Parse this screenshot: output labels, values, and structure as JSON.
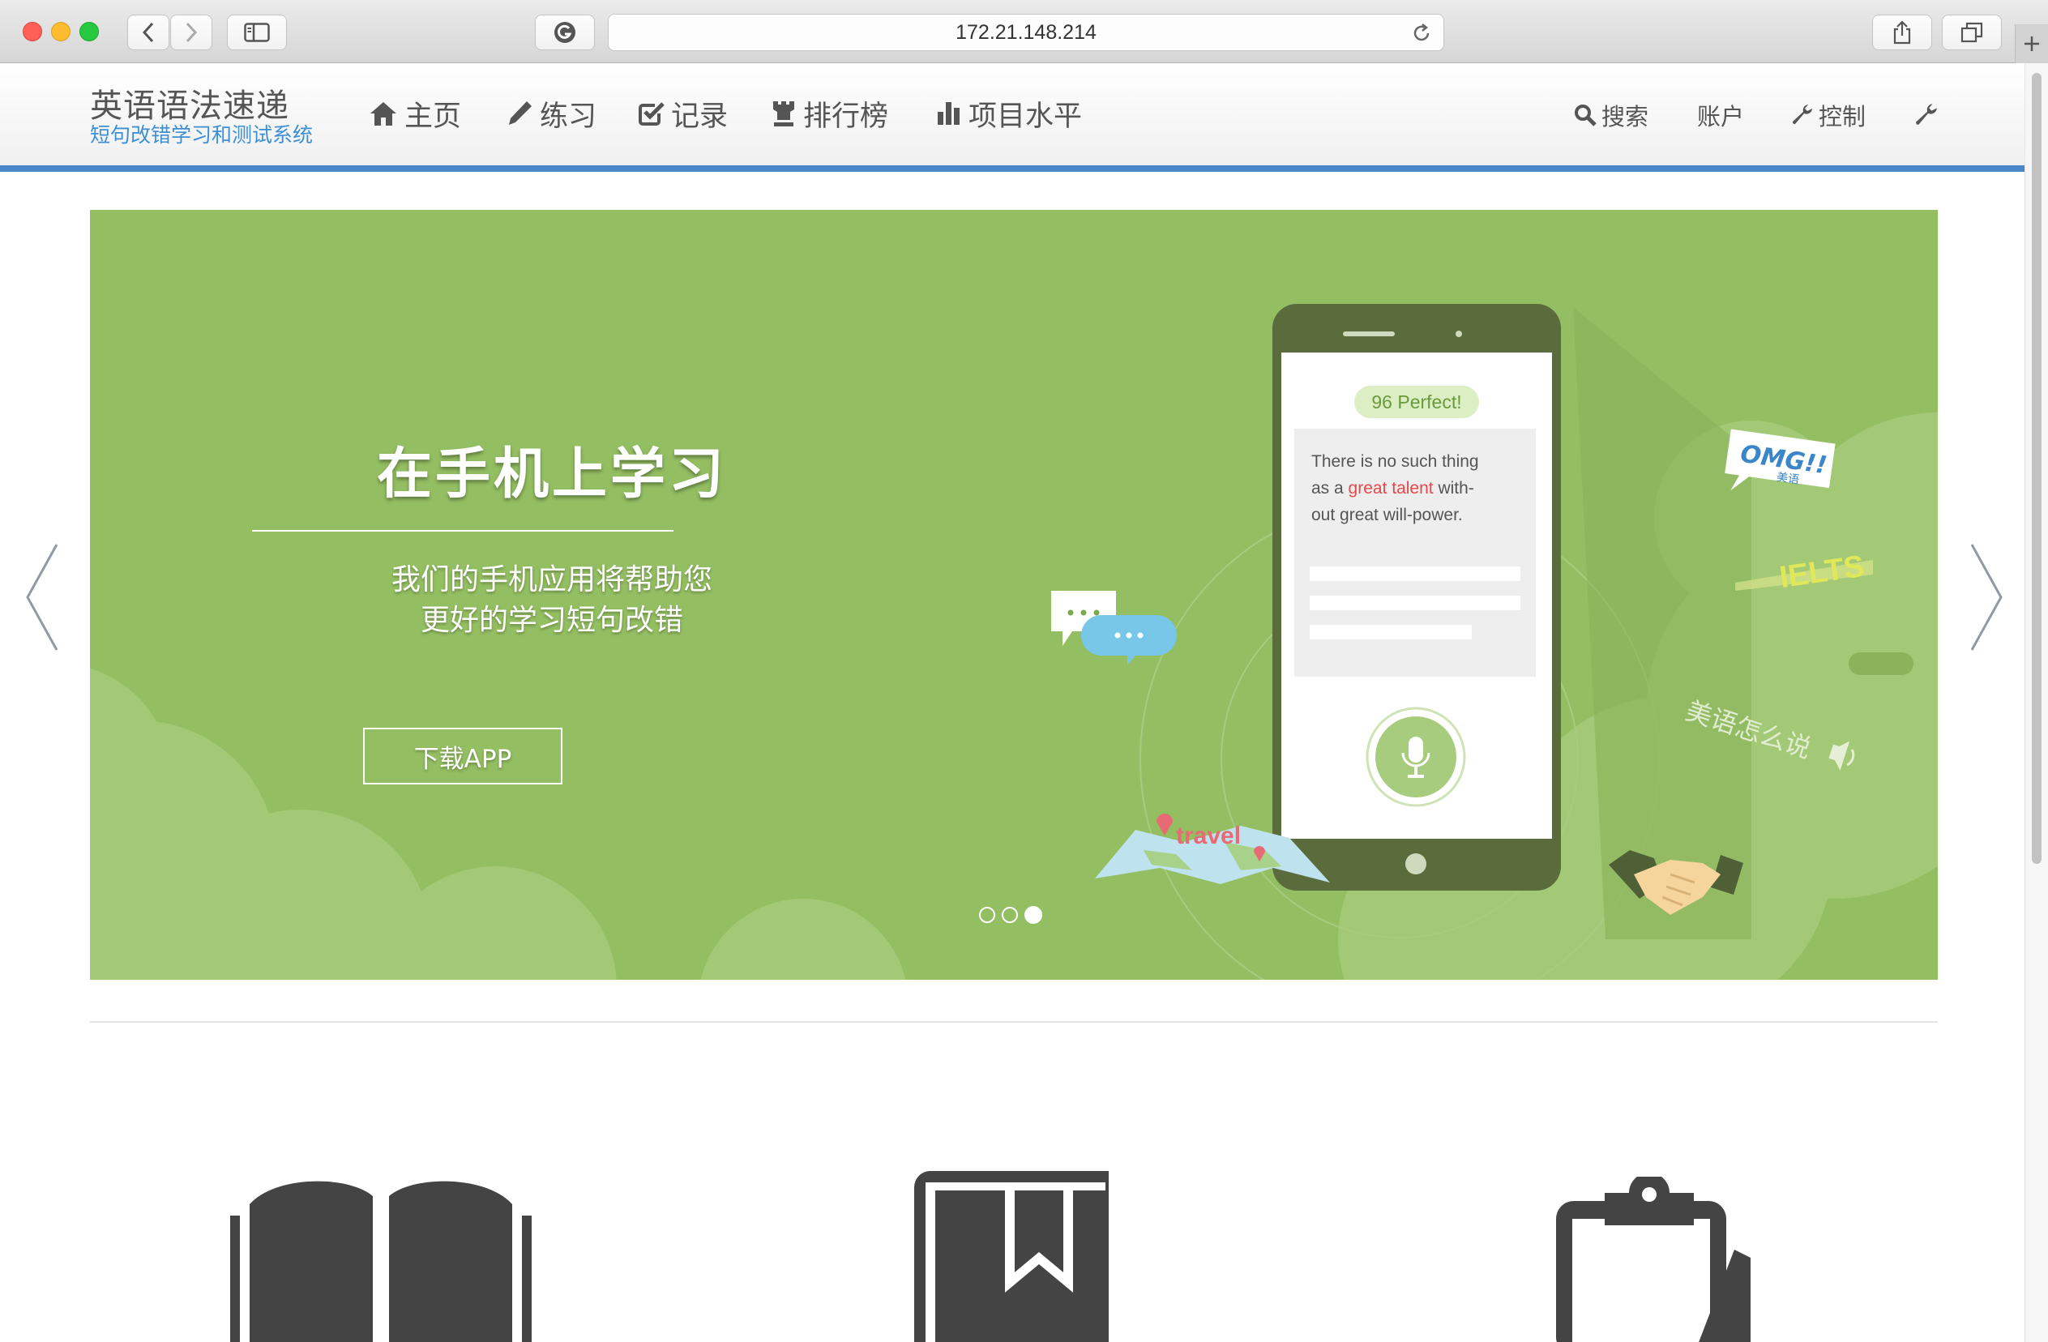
{
  "browser": {
    "url": "172.21.148.214"
  },
  "site": {
    "brand_title": "英语语法速递",
    "brand_subtitle": "短句改错学习和测试系统",
    "nav": [
      {
        "label": "主页",
        "icon": "home-icon"
      },
      {
        "label": "练习",
        "icon": "pencil-icon"
      },
      {
        "label": "记录",
        "icon": "checkbox-icon"
      },
      {
        "label": "排行榜",
        "icon": "rook-icon"
      },
      {
        "label": "项目水平",
        "icon": "bar-chart-icon"
      }
    ],
    "nav_right": [
      {
        "label": "搜索",
        "icon": "search-icon"
      },
      {
        "label": "账户",
        "icon": ""
      },
      {
        "label": "控制",
        "icon": "wrench-icon"
      },
      {
        "label": "",
        "icon": "wrench-icon"
      }
    ],
    "accent_color": "#4a86c8"
  },
  "carousel": {
    "headline": "在手机上学习",
    "subtitle_line1": "我们的手机应用将帮助您",
    "subtitle_line2": "更好的学习短句改错",
    "button_label": "下载APP",
    "slide_count": 3,
    "active_slide": 3,
    "background_color": "#94be62",
    "phone": {
      "score_badge": "96 Perfect!",
      "sentence_part1": "There is no such thing",
      "sentence_part2_a": "as a ",
      "sentence_highlight": "great talent",
      "sentence_part2_b": " with-",
      "sentence_part3": "out great will-power."
    },
    "stickers": {
      "omg": "OMG!!",
      "omg_sub": "美语",
      "ielts": "IELTS",
      "american_speak": "美语怎么说",
      "travel": "travel"
    }
  },
  "features": [
    {
      "icon": "open-book-icon"
    },
    {
      "icon": "bookmark-book-icon"
    },
    {
      "icon": "clipboard-icon"
    }
  ]
}
